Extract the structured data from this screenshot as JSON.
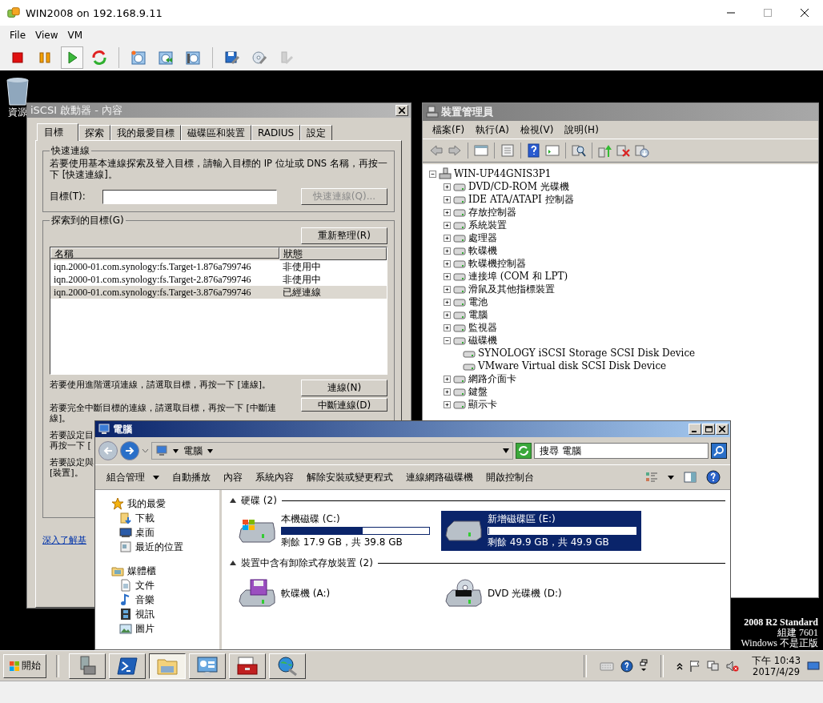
{
  "window": {
    "title": "WIN2008 on 192.168.9.11"
  },
  "menu": [
    {
      "label": "File"
    },
    {
      "label": "View"
    },
    {
      "label": "VM"
    }
  ],
  "toolbar_groups": [
    [
      {
        "kind": "stop",
        "pressed": false,
        "disabled": false
      },
      {
        "kind": "pause",
        "pressed": false,
        "disabled": false
      },
      {
        "kind": "play",
        "pressed": true,
        "disabled": false
      },
      {
        "kind": "reset",
        "pressed": false,
        "disabled": false
      }
    ],
    [
      {
        "kind": "snapshot",
        "pressed": false,
        "disabled": false
      },
      {
        "kind": "revert",
        "pressed": false,
        "disabled": false
      },
      {
        "kind": "snapshot-manager",
        "pressed": false,
        "disabled": false
      }
    ],
    [
      {
        "kind": "edit-settings",
        "pressed": false,
        "disabled": false
      },
      {
        "kind": "cd",
        "pressed": false,
        "disabled": false
      },
      {
        "kind": "usb",
        "pressed": false,
        "disabled": true
      }
    ]
  ],
  "desktop": {
    "icons": [
      {
        "label": "資源"
      }
    ],
    "edition_lines": [
      "2008 R2 Standard",
      "組建 7601",
      "Windows 不是正版"
    ]
  },
  "iscsi_dialog": {
    "title": "iSCSI 啟動器 - 內容",
    "tabs": [
      {
        "label": "目標",
        "selected": true
      },
      {
        "label": "探索",
        "selected": false
      },
      {
        "label": "我的最愛目標",
        "selected": false
      },
      {
        "label": "磁碟區和裝置",
        "selected": false
      },
      {
        "label": "RADIUS",
        "selected": false
      },
      {
        "label": "設定",
        "selected": false
      }
    ],
    "quick_connect": {
      "title": "快速連線",
      "description": "若要使用基本連線探索及登入目標，請輸入目標的 IP 位址或 DNS 名稱，再按一下 [快速連線]。",
      "target_label": "目標(T):",
      "button": {
        "label": "快速連線(Q)...",
        "disabled": true
      }
    },
    "discovered": {
      "title": "探索到的目標(G)",
      "refresh_button": "重新整理(R)",
      "columns": [
        "名稱",
        "狀態"
      ],
      "rows": [
        {
          "name": "iqn.2000-01.com.synology:fs.Target-1.876a799746",
          "status": "非使用中",
          "selected": false
        },
        {
          "name": "iqn.2000-01.com.synology:fs.Target-2.876a799746",
          "status": "非使用中",
          "selected": false
        },
        {
          "name": "iqn.2000-01.com.synology:fs.Target-3.876a799746",
          "status": "已經連線",
          "selected": true
        }
      ],
      "connect_text": "若要使用進階選項連線，請選取目標，再按一下 [連線]。",
      "connect_button": "連線(N)",
      "disconnect_text": "若要完全中斷目標的連線，請選取目標，再按一下 [中斷連線]。",
      "disconnect_button": "中斷連線(D)",
      "covered_texts": [
        [
          "若要設定目",
          "再按一下 ["
        ],
        [
          "若要設定與",
          "[裝置]。"
        ]
      ]
    },
    "link": "深入了解基"
  },
  "device_manager": {
    "title": "裝置管理員",
    "menu": [
      "檔案(F)",
      "執行(A)",
      "檢視(V)",
      "說明(H)"
    ],
    "tree": {
      "label": "WIN-UP44GNIS3P1",
      "expanded": true,
      "children": [
        {
          "label": "DVD/CD-ROM 光碟機",
          "expanded": false
        },
        {
          "label": "IDE ATA/ATAPI 控制器",
          "expanded": false
        },
        {
          "label": "存放控制器",
          "expanded": false
        },
        {
          "label": "系統裝置",
          "expanded": false
        },
        {
          "label": "處理器",
          "expanded": false
        },
        {
          "label": "軟碟機",
          "expanded": false
        },
        {
          "label": "軟碟機控制器",
          "expanded": false
        },
        {
          "label": "連接埠 (COM 和 LPT)",
          "expanded": false
        },
        {
          "label": "滑鼠及其他指標裝置",
          "expanded": false
        },
        {
          "label": "電池",
          "expanded": false
        },
        {
          "label": "電腦",
          "expanded": false
        },
        {
          "label": "監視器",
          "expanded": false
        },
        {
          "label": "磁碟機",
          "expanded": true,
          "children": [
            {
              "label": "SYNOLOGY iSCSI Storage SCSI Disk Device"
            },
            {
              "label": "VMware Virtual disk SCSI Disk Device"
            }
          ]
        },
        {
          "label": "網路介面卡",
          "expanded": false
        },
        {
          "label": "鍵盤",
          "expanded": false
        },
        {
          "label": "顯示卡",
          "expanded": false
        }
      ]
    }
  },
  "explorer": {
    "title": "電腦",
    "address": "電腦",
    "search_placeholder": "搜尋 電腦",
    "commands": [
      {
        "label": "組合管理",
        "dropdown": true
      },
      {
        "label": "自動播放",
        "dropdown": false
      },
      {
        "label": "內容",
        "dropdown": false
      },
      {
        "label": "系統內容",
        "dropdown": false
      },
      {
        "label": "解除安裝或變更程式",
        "dropdown": false
      },
      {
        "label": "連線網路磁碟機",
        "dropdown": false
      },
      {
        "label": "開啟控制台",
        "dropdown": false
      }
    ],
    "nav": [
      {
        "label": "我的最愛",
        "kind": "favorites",
        "children": [
          {
            "label": "下載",
            "kind": "downloads"
          },
          {
            "label": "桌面",
            "kind": "desktop"
          },
          {
            "label": "最近的位置",
            "kind": "recent"
          }
        ]
      },
      {
        "label": "媒體櫃",
        "kind": "libraries",
        "children": [
          {
            "label": "文件",
            "kind": "documents"
          },
          {
            "label": "音樂",
            "kind": "music"
          },
          {
            "label": "視訊",
            "kind": "videos"
          },
          {
            "label": "圖片",
            "kind": "pictures"
          }
        ]
      }
    ],
    "sections": [
      {
        "title": "硬碟 (2)",
        "items": [
          {
            "name": "本機磁碟 (C:)",
            "kind": "system-disk",
            "level": 0.55,
            "free": "剩餘 17.9 GB，共 39.8 GB",
            "selected": false
          },
          {
            "name": "新增磁碟區 (E:)",
            "kind": "disk",
            "level": 0,
            "free": "剩餘 49.9 GB，共 49.9 GB",
            "selected": true
          }
        ]
      },
      {
        "title": "裝置中含有卸除式存放裝置 (2)",
        "items": [
          {
            "name": "軟碟機 (A:)",
            "kind": "floppy",
            "selected": false
          },
          {
            "name": "DVD 光碟機 (D:)",
            "kind": "dvd",
            "selected": false
          }
        ]
      }
    ]
  },
  "taskbar": {
    "start": "開始",
    "apps": [
      {
        "kind": "server-manager",
        "selected": false
      },
      {
        "kind": "powershell",
        "selected": false
      },
      {
        "kind": "explorer",
        "selected": true
      },
      {
        "kind": "control-panel",
        "selected": false
      },
      {
        "kind": "toolbox",
        "selected": false
      },
      {
        "kind": "network",
        "selected": false
      }
    ],
    "clock": {
      "time": "下午 10:43",
      "date": "2017/4/29"
    }
  }
}
